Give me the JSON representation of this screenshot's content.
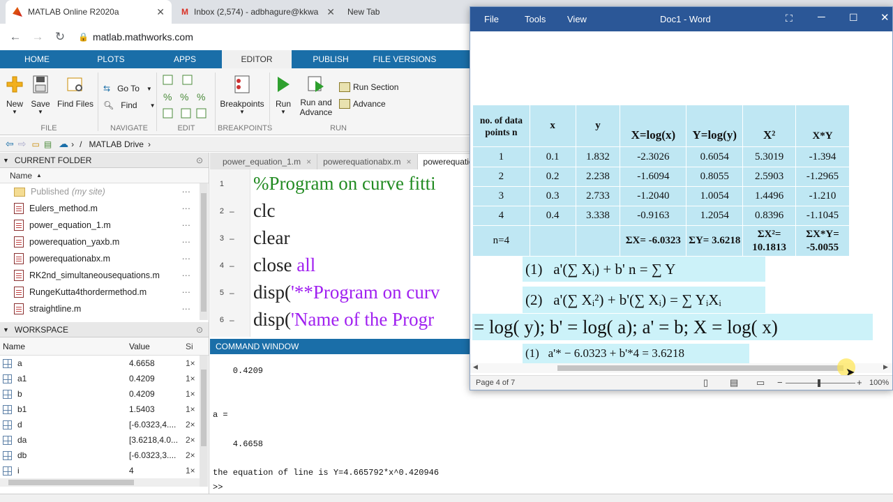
{
  "browser": {
    "tabs": [
      {
        "label": "MATLAB Online R2020a"
      },
      {
        "label": "Inbox (2,574) - adbhagure@kkwa"
      },
      {
        "label": "New Tab"
      }
    ],
    "url": "matlab.mathworks.com"
  },
  "ribbon": {
    "tabs": [
      "HOME",
      "PLOTS",
      "APPS",
      "EDITOR",
      "PUBLISH",
      "FILE VERSIONS"
    ],
    "buttons": {
      "new": "New",
      "save": "Save",
      "find_files": "Find Files",
      "go_to": "Go To",
      "find": "Find",
      "breakpoints": "Breakpoints",
      "run": "Run",
      "run_and_advance": "Run and Advance",
      "run_section": "Run Section",
      "advance": "Advance"
    },
    "groups": [
      "FILE",
      "NAVIGATE",
      "EDIT",
      "BREAKPOINTS",
      "RUN"
    ]
  },
  "path": {
    "drive": "MATLAB Drive",
    "sep": "/"
  },
  "current_folder": {
    "title": "CURRENT FOLDER",
    "column": "Name",
    "published": "Published",
    "published_note": "(my site)",
    "files": [
      "Eulers_method.m",
      "power_equation_1.m",
      "powerequation_yaxb.m",
      "powerequationabx.m",
      "RK2nd_simultaneousequations.m",
      "RungeKutta4thordermethod.m",
      "straightline.m"
    ]
  },
  "workspace": {
    "title": "WORKSPACE",
    "columns": [
      "Name",
      "Value",
      "Si"
    ],
    "rows": [
      {
        "name": "a",
        "value": "4.6658",
        "size": "1×"
      },
      {
        "name": "a1",
        "value": "0.4209",
        "size": "1×"
      },
      {
        "name": "b",
        "value": "0.4209",
        "size": "1×"
      },
      {
        "name": "b1",
        "value": "1.5403",
        "size": "1×"
      },
      {
        "name": "d",
        "value": "[-6.0323,4....",
        "size": "2×"
      },
      {
        "name": "da",
        "value": "[3.6218,4.0...",
        "size": "2×"
      },
      {
        "name": "db",
        "value": "[-6.0323,3....",
        "size": "2×"
      },
      {
        "name": "i",
        "value": "4",
        "size": "1×"
      }
    ]
  },
  "editor": {
    "tabs": [
      "power_equation_1.m",
      "powerequationabx.m",
      "powerequatio"
    ],
    "lines": [
      {
        "num": "1",
        "mark": "",
        "parts": [
          {
            "t": "%Program on curve fitti",
            "c": "cmt"
          }
        ]
      },
      {
        "num": "2",
        "mark": "–",
        "parts": [
          {
            "t": "clc",
            "c": ""
          }
        ]
      },
      {
        "num": "3",
        "mark": "–",
        "parts": [
          {
            "t": "clear",
            "c": ""
          }
        ]
      },
      {
        "num": "4",
        "mark": "–",
        "parts": [
          {
            "t": "close ",
            "c": ""
          },
          {
            "t": "all",
            "c": "kw"
          }
        ]
      },
      {
        "num": "5",
        "mark": "–",
        "parts": [
          {
            "t": "disp(",
            "c": ""
          },
          {
            "t": "'**Program on curv",
            "c": "str"
          }
        ]
      },
      {
        "num": "6",
        "mark": "–",
        "parts": [
          {
            "t": "disp(",
            "c": ""
          },
          {
            "t": "'Name of the Progr",
            "c": "str"
          }
        ]
      }
    ]
  },
  "command_window": {
    "title": "COMMAND WINDOW",
    "lines": [
      "    0.4209",
      "",
      "",
      "a =",
      "",
      "    4.6658",
      "",
      "the equation of line is Y=4.665792*x^0.420946",
      ">>"
    ]
  },
  "word": {
    "menu": [
      "File",
      "Tools",
      "View"
    ],
    "title": "Doc1 - Word",
    "status": "Page 4 of 7",
    "zoom": "100%",
    "table": {
      "headers": [
        "no. of data points n",
        "x",
        "y",
        "X=log(x)",
        "Y=log(y)",
        "X²",
        "X*Y"
      ],
      "rows": [
        [
          "1",
          "0.1",
          "1.832",
          "-2.3026",
          "0.6054",
          "5.3019",
          "-1.394"
        ],
        [
          "2",
          "0.2",
          "2.238",
          "-1.6094",
          "0.8055",
          "2.5903",
          "-1.2965"
        ],
        [
          "3",
          "0.3",
          "2.733",
          "-1.2040",
          "1.0054",
          "1.4496",
          "-1.210"
        ],
        [
          "4",
          "0.4",
          "3.338",
          "-0.9163",
          "1.2054",
          "0.8396",
          "-1.1045"
        ]
      ],
      "sum_row": [
        "n=4",
        "",
        "",
        "ΣX= -6.0323",
        "ΣY= 3.6218",
        "ΣX²= 10.1813",
        "ΣX*Y= -5.0055"
      ]
    },
    "equations": [
      "(1)   a'(∑ Xᵢ) + b' n = ∑ Y",
      "(2)   a'(∑ Xᵢ²) + b'(∑ Xᵢ) = ∑ YᵢXᵢ",
      "= log( y); b' = log( a); a' = b; X = log( x)",
      "(1)   a'* − 6.0323 + b'*4 = 3.6218"
    ]
  },
  "colors": {
    "matlab_blue": "#1a6ea8",
    "word_blue": "#2b5797",
    "table_bg": "#bfe7f3",
    "comment": "#228b22",
    "string": "#a020f0"
  }
}
